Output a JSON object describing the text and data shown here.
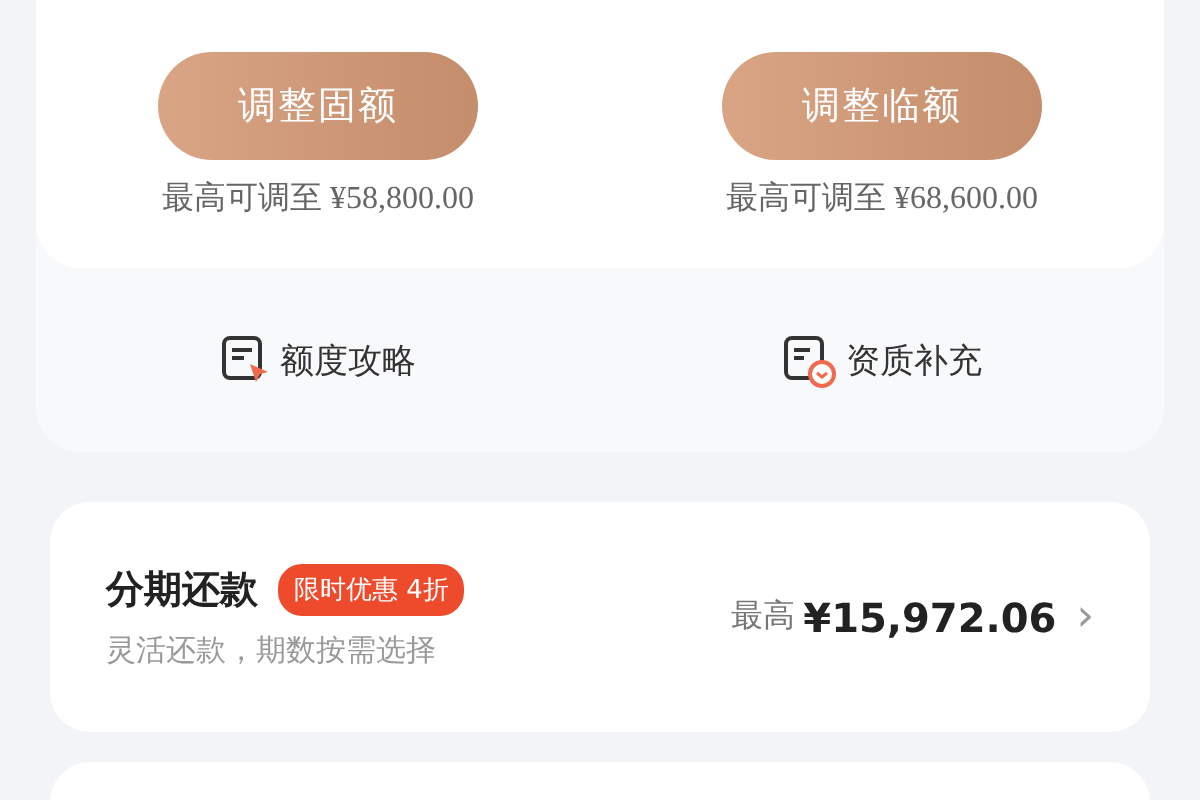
{
  "limits": [
    {
      "button": "调整固额",
      "caption": "最高可调至 ¥58,800.00"
    },
    {
      "button": "调整临额",
      "caption": "最高可调至 ¥68,600.00"
    }
  ],
  "links": [
    {
      "kind": "guide",
      "label": "额度攻略"
    },
    {
      "kind": "supplement",
      "label": "资质补充"
    }
  ],
  "installment": {
    "title": "分期还款",
    "badge": "限时优惠 4折",
    "subtitle": "灵活还款，期数按需选择",
    "amount_label": "最高",
    "amount": "¥15,972.06",
    "chevron": "›"
  }
}
